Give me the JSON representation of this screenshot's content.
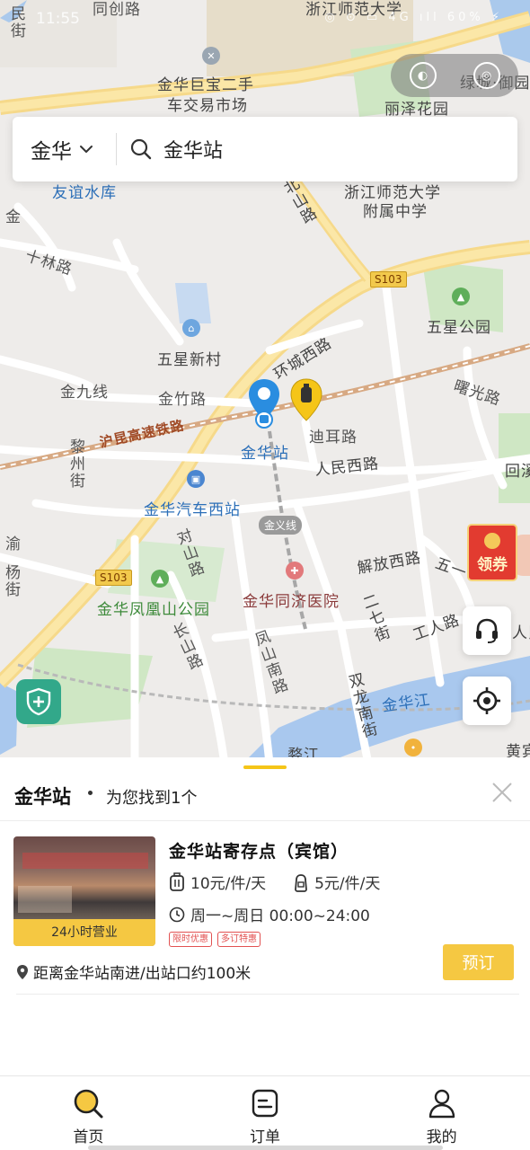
{
  "status_bar": {
    "time": "11:55",
    "icons_text": "◎ ⊙ ▭ 4G ıll 60% ⚡"
  },
  "map": {
    "labels": {
      "road_tongchuang": "同创路",
      "zhejiang_normal": "浙江师范大学",
      "jubao_market_1": "金华巨宝二手",
      "jubao_market_2": "车交易市场",
      "lvcheng": "绿城·御园",
      "lize_garden": "丽泽花园",
      "friendship_reservoir": "友谊水库",
      "zj_normal_affiliated_1": "浙江师范大学",
      "zj_normal_affiliated_2": "附属中学",
      "beishan_road": "北山路",
      "shilin_road": "十林路",
      "s103_top": "S103",
      "wuxing_park": "五星公园",
      "wuxing_village": "五星新村",
      "huancheng_west": "环城西路",
      "jinjiu_line": "金九线",
      "jinzhu_road": "金竹路",
      "shuguang_road": "曙光路",
      "hukun_railway": "沪昆高速铁路",
      "jinhua_station": "金华站",
      "dier_road": "迪耳路",
      "lizhou_street": "黎州街",
      "renmin_west": "人民西路",
      "huixi": "回溪",
      "jinhua_bus_west": "金华汽车西站",
      "jinyi_line": "金义线",
      "duishan_road": "对山路",
      "jiefang_west": "解放西路",
      "wuyi": "五一",
      "s103_mid": "S103",
      "fenghuang_park": "金华凤凰山公园",
      "tongji_hospital": "金华同济医院",
      "erqi_street": "二七街",
      "gongren_road": "工人路",
      "renmin": "人民",
      "changshan_road": "长山路",
      "fengshan_south": "凤山南路",
      "shuanglong_south": "双龙南街",
      "jinhua_river": "金华江",
      "wujiang": "婺江",
      "huangbin": "黄宾",
      "left_edge_1": "民街",
      "left_edge_2": "渝",
      "left_edge_3": "金",
      "left_edge_4": "杨街"
    }
  },
  "search": {
    "city": "金华",
    "query": "金华站"
  },
  "promo": {
    "label": "领券"
  },
  "sheet": {
    "title": "金华站",
    "subtitle": "为您找到1个",
    "result": {
      "name": "金华站寄存点（宾馆）",
      "thumb_badge": "24小时营业",
      "price_large": "10元/件/天",
      "price_small": "5元/件/天",
      "hours": "周一~周日 00:00~24:00",
      "tags": [
        "限时优惠",
        "多订特惠"
      ],
      "distance": "距离金华站南进/出站口约100米",
      "book_label": "预订"
    }
  },
  "tabs": [
    {
      "label": "首页",
      "icon": "search-icon"
    },
    {
      "label": "订单",
      "icon": "orders-icon"
    },
    {
      "label": "我的",
      "icon": "profile-icon"
    }
  ],
  "colors": {
    "accent": "#f5c842",
    "tag_red": "#e25252",
    "pin_blue": "#2a8de0",
    "safety_green": "#32a88a"
  }
}
